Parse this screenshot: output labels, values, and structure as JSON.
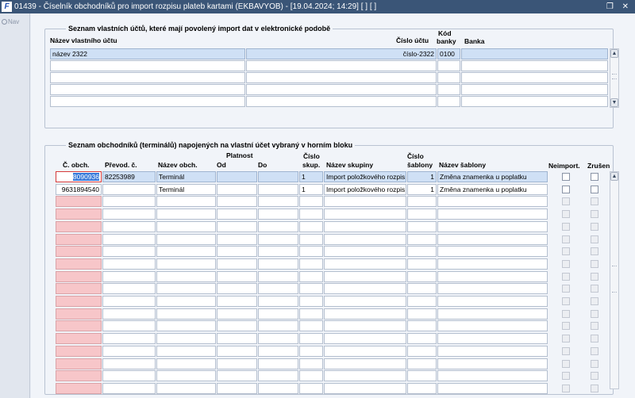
{
  "window": {
    "title": "01439 - Číselník obchodníků pro import rozpisu plateb kartami (EKBAVYOB) - [19.04.2024; 14:29] [ ] [ ]",
    "app_icon": "F",
    "controls": "❐ ✕"
  },
  "nav": {
    "label": "Nav"
  },
  "accounts": {
    "legend": "Seznam vlastních účtů, které mají povolený import dat v elektronické podobě",
    "headers": {
      "name": "Název vlastního účtu",
      "number": "Číslo účtu",
      "bank_code_line1": "Kód",
      "bank_code_line2": "banky",
      "bank": "Banka"
    },
    "rows": [
      {
        "name": "název 2322",
        "blank": "",
        "number": "číslo-2322",
        "code": "0100",
        "bank": ""
      }
    ]
  },
  "merchants": {
    "legend": "Seznam obchodníků (terminálů) napojených na vlastní účet vybraný v horním bloku",
    "headers": {
      "obch_no": "Č. obch.",
      "prevod": "Převod. č.",
      "name": "Název obch.",
      "validity": "Platnost",
      "from": "Od",
      "to": "Do",
      "group_no_line1": "Číslo",
      "group_no_line2": "skup.",
      "group_name": "Název skupiny",
      "tpl_no_line1": "Číslo",
      "tpl_no_line2": "šablony",
      "tpl_name": "Název šablony",
      "neimport": "Neimport.",
      "zrusen": "Zrušen"
    },
    "rows": [
      {
        "obch_no": "8090936",
        "prevod": "82253989",
        "name": "Terminál",
        "from": "",
        "to": "",
        "group_no": "1",
        "group_name": "Import položkového rozpis",
        "tpl_no": "1",
        "tpl_name": "Změna znamenka u poplatku"
      },
      {
        "obch_no": "9631894540",
        "prevod": "",
        "name": "Terminál",
        "from": "",
        "to": "",
        "group_no": "1",
        "group_name": "Import položkového rozpis",
        "tpl_no": "1",
        "tpl_name": "Změna znamenka u poplatku"
      }
    ]
  },
  "icons": {
    "scroll_up": "▲",
    "scroll_down": "▼"
  }
}
